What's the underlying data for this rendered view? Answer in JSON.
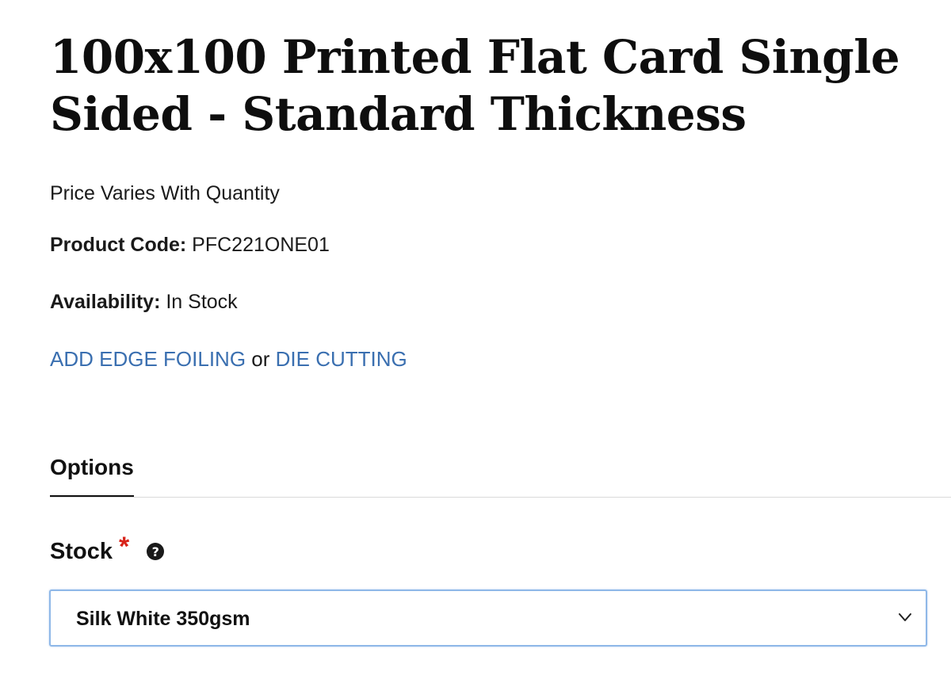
{
  "product": {
    "title": "100x100 Printed Flat Card Single Sided - Standard Thickness",
    "price_note": "Price Varies With Quantity",
    "product_code_label": "Product Code:",
    "product_code": "PFC221ONE01",
    "availability_label": "Availability:",
    "availability": "In Stock"
  },
  "links": {
    "edge_foiling": "ADD EDGE FOILING",
    "separator": "or",
    "die_cutting": "DIE CUTTING",
    "link_color": "#3a6fb0"
  },
  "tabs": {
    "options_label": "Options"
  },
  "stock_field": {
    "label": "Stock",
    "required_marker": "*",
    "help_icon": "question-circle-icon",
    "selected_value": "Silk White 350gsm",
    "dropdown_icon": "chevron-down-icon"
  },
  "colors": {
    "required": "#d8231a",
    "focus_border": "#8fb8e8"
  }
}
